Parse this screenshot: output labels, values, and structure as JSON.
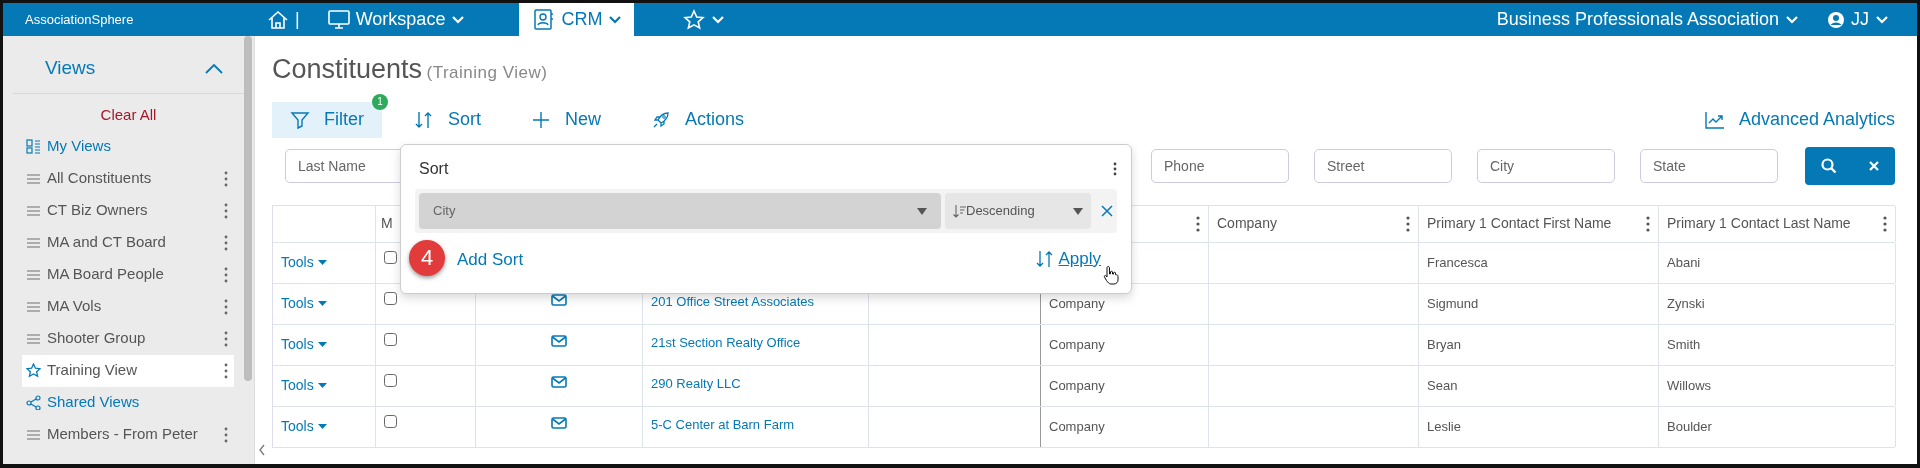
{
  "topbar": {
    "logo": "AssociationSphere",
    "separator": "|",
    "menus": [
      {
        "label": "Workspace",
        "selected": false
      },
      {
        "label": "CRM",
        "selected": true
      },
      {
        "selected": false
      }
    ],
    "org": "Business Professionals Association",
    "user": "JJ"
  },
  "sidebar": {
    "title": "Views",
    "expanded": true,
    "clear": "Clear All",
    "items": [
      {
        "kind": "mygroup",
        "label": "My Views"
      },
      {
        "kind": "view",
        "label": "All Constituents",
        "selected": false,
        "favorite": false
      },
      {
        "kind": "view",
        "label": "CT Biz Owners",
        "selected": false,
        "favorite": false
      },
      {
        "kind": "view",
        "label": "MA and CT Board",
        "selected": false,
        "favorite": false
      },
      {
        "kind": "view",
        "label": "MA Board People",
        "selected": false,
        "favorite": false
      },
      {
        "kind": "view",
        "label": "MA Vols",
        "selected": false,
        "favorite": false
      },
      {
        "kind": "view",
        "label": "Shooter Group",
        "selected": false,
        "favorite": false
      },
      {
        "kind": "view",
        "label": "Training View",
        "selected": true,
        "favorite": true
      },
      {
        "kind": "sharedgroup",
        "label": "Shared Views"
      },
      {
        "kind": "view",
        "label": "Members - From Peter",
        "selected": false,
        "favorite": false
      }
    ]
  },
  "page": {
    "title": "Constituents",
    "subtitle": "(Training View)"
  },
  "toolbar": [
    {
      "label": "Filter",
      "badge": "1",
      "selected": true
    },
    {
      "label": "Sort",
      "selected": false
    },
    {
      "label": "New",
      "selected": false
    },
    {
      "label": "Actions",
      "selected": false
    }
  ],
  "analytics": "Advanced Analytics",
  "filters": [
    {
      "placeholder": "Last Name"
    },
    {
      "placeholder": "Phone"
    },
    {
      "placeholder": "Street"
    },
    {
      "placeholder": "City"
    },
    {
      "placeholder": "State"
    }
  ],
  "table": {
    "columns": [
      {
        "menu": false
      },
      {
        "label": "M"
      },
      {},
      {},
      {},
      {
        "menu": true
      },
      {
        "label": "Company",
        "menu": true
      },
      {
        "label": "Primary 1 Contact First Name",
        "menu": true
      },
      {
        "label": "Primary 1 Contact Last Name",
        "menu": true
      }
    ],
    "rows": [
      {
        "tools": "Tools",
        "checked": false,
        "first": "Francesca",
        "last": "Abani"
      },
      {
        "tools": "Tools",
        "checked": false,
        "email": true,
        "name": "201 Office Street Associates",
        "type": "Company",
        "first": "Sigmund",
        "last": "Zynski"
      },
      {
        "tools": "Tools",
        "checked": false,
        "email": true,
        "name": "21st Section Realty Office",
        "type": "Company",
        "first": "Bryan",
        "last": "Smith"
      },
      {
        "tools": "Tools",
        "checked": false,
        "email": true,
        "name": "290 Realty LLC",
        "type": "Company",
        "first": "Sean",
        "last": "Willows"
      },
      {
        "tools": "Tools",
        "checked": false,
        "email": true,
        "name": "5-C Center at Barn Farm",
        "type": "Company",
        "first": "Leslie",
        "last": "Boulder"
      }
    ]
  },
  "sort_popup": {
    "title": "Sort",
    "field": "City",
    "direction": "Descending",
    "add": "Add Sort",
    "apply": "Apply",
    "step": "4"
  }
}
